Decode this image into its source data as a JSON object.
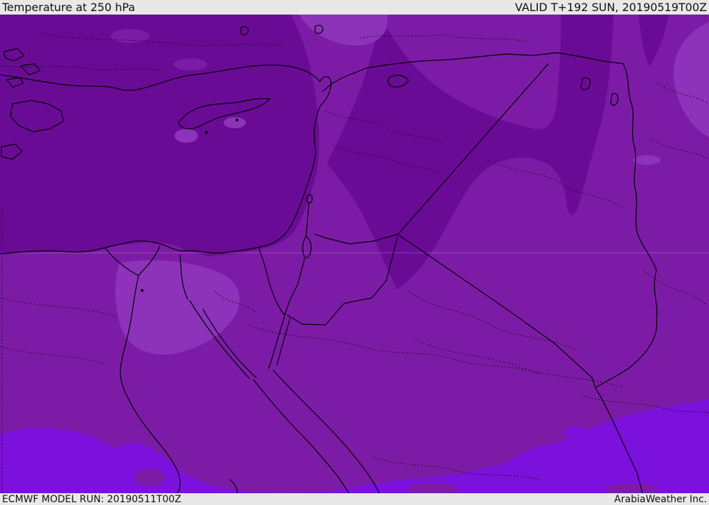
{
  "header": {
    "title": "Temperature at 250 hPa",
    "valid_label": "VALID T+192 SUN, 20190519T00Z"
  },
  "footer": {
    "model_run_label": "ECMWF MODEL RUN: 20190511T00Z",
    "credit": "ArabiaWeather Inc."
  },
  "map": {
    "parameter": "Temperature",
    "level": "250 hPa",
    "model": "ECMWF",
    "run": "20190511T00Z",
    "valid": "T+192 SUN 20190519T00Z",
    "palette": {
      "band_dark": "#6a0b96",
      "band_mid": "#7c1ca6",
      "band_light": "#8d33ba",
      "band_bright": "#7c10dc",
      "bar_bg": "#e8e8e8",
      "bar_text": "#111111",
      "border_line": "#000000",
      "dotted_line": "#2a0a2e",
      "graticule": "#c9a8d6"
    }
  }
}
